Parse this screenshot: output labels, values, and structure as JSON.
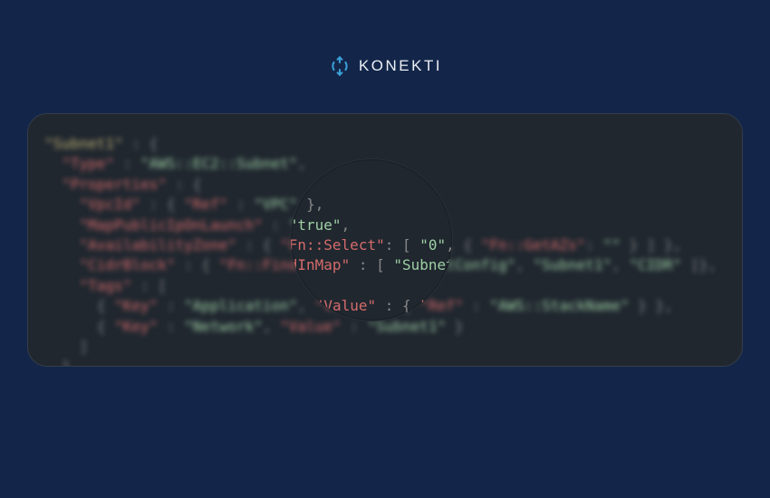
{
  "brand": {
    "name": "KONEKTI"
  },
  "colors": {
    "page_bg": "#13264a",
    "card_bg": "#20272f",
    "card_border": "#353d47",
    "text": "#eceff4",
    "code_key": "#d46b6b",
    "code_string": "#9ecfa4",
    "code_struct": "#c0b074",
    "code_punct": "#888888",
    "logo_icon": "#3aa0d8"
  },
  "code": {
    "resource_name": "Subnet1",
    "type_label": "Type",
    "type_value": "AWS::EC2::Subnet",
    "properties_label": "Properties",
    "vpcid_label": "VpcId",
    "ref_label": "Ref",
    "ref_vpc": "VPC",
    "map_public_label": "MapPublicIpOnLaunch",
    "map_public_value": "true",
    "az_label": "AvailabilityZone",
    "fn_select": "Fn::Select",
    "select_index": "0",
    "fn_getazs": "Fn::GetAZs",
    "getazs_arg": "",
    "cidr_label": "CidrBlock",
    "fn_findinmap": "Fn::FindInMap",
    "findinmap_arg1": "SubnetConfig",
    "findinmap_arg2": "Subnet1",
    "findinmap_arg3": "CIDR",
    "tags_label": "Tags",
    "tag_key_label": "Key",
    "tag_value_label": "Value",
    "tag1_key": "Application",
    "tag1_value_ref": "AWS::StackName",
    "tag2_key": "Network",
    "tag2_value": "Subnet1"
  }
}
